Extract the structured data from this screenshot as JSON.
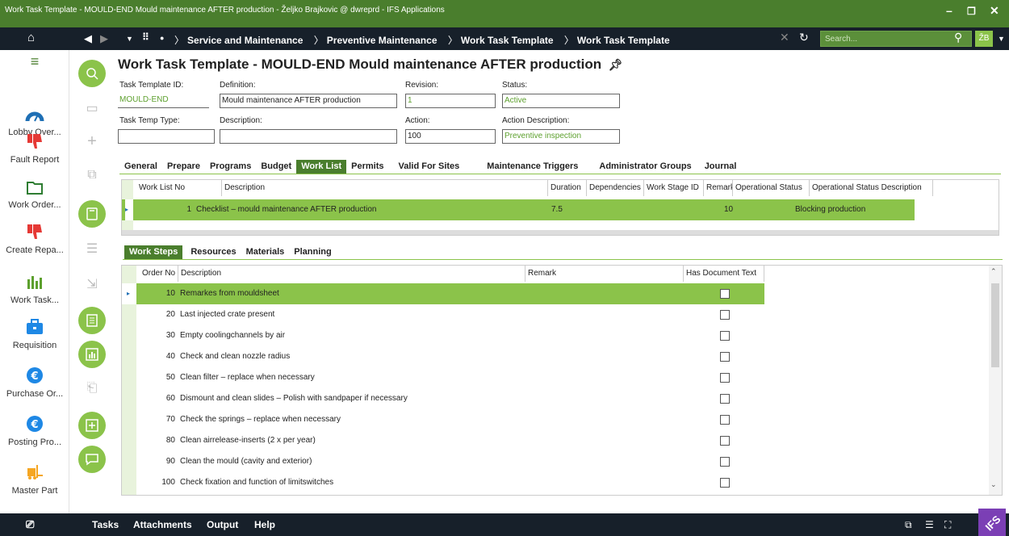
{
  "window": {
    "title": "Work Task Template - MOULD-END Mould maintenance AFTER production - Željko Brajkovic @ dwreprd - IFS Applications"
  },
  "nav": {
    "breadcrumbs": [
      "Service and Maintenance",
      "Preventive Maintenance",
      "Work Task Template",
      "Work Task Template"
    ],
    "search_placeholder": "Search...",
    "user_initials": "ŽB"
  },
  "sidebar": {
    "items": [
      {
        "label": "Lobby Over...",
        "icon": "gauge-icon"
      },
      {
        "label": "Fault Report",
        "icon": "thumbs-down-icon"
      },
      {
        "label": "Work Order...",
        "icon": "folder-icon"
      },
      {
        "label": "Create Repa...",
        "icon": "thumbs-down-icon"
      },
      {
        "label": "Work Task...",
        "icon": "bar-chart-icon"
      },
      {
        "label": "Requisition",
        "icon": "briefcase-icon"
      },
      {
        "label": "Purchase Or...",
        "icon": "euro-bag-icon"
      },
      {
        "label": "Posting Pro...",
        "icon": "euro-bag-icon"
      },
      {
        "label": "Master Part",
        "icon": "forklift-icon"
      }
    ]
  },
  "header": {
    "title": "Work Task Template - MOULD-END Mould maintenance AFTER production",
    "fields": {
      "task_template_id": {
        "label": "Task Template ID:",
        "value": "MOULD-END"
      },
      "definition": {
        "label": "Definition:",
        "value": "Mould maintenance AFTER production"
      },
      "revision": {
        "label": "Revision:",
        "value": "1"
      },
      "status": {
        "label": "Status:",
        "value": "Active"
      },
      "task_temp_type": {
        "label": "Task Temp Type:",
        "value": ""
      },
      "description": {
        "label": "Description:",
        "value": ""
      },
      "action": {
        "label": "Action:",
        "value": "100"
      },
      "action_description": {
        "label": "Action Description:",
        "value": "Preventive inspection"
      }
    }
  },
  "main_tabs": [
    "General",
    "Prepare",
    "Programs",
    "Budget",
    "Work List",
    "Permits",
    "Valid For Sites",
    "Maintenance Triggers",
    "Administrator Groups",
    "Journal"
  ],
  "work_list": {
    "columns": [
      "Work List No",
      "Description",
      "Duration",
      "Dependencies",
      "Work Stage ID",
      "Remark",
      "Operational Status",
      "Operational Status Description"
    ],
    "rows": [
      {
        "no": "1",
        "description": "Checklist – mould maintenance AFTER  production",
        "duration": "7.5",
        "dependencies": "",
        "work_stage_id": "",
        "remark": "",
        "op_status": "10",
        "op_status_desc": "Blocking production"
      }
    ]
  },
  "sub_tabs": [
    "Work Steps",
    "Resources",
    "Materials",
    "Planning"
  ],
  "work_steps": {
    "columns": [
      "Order No",
      "Description",
      "Remark",
      "Has Document Text"
    ],
    "rows": [
      {
        "order": "10",
        "description": "Remarkes from mouldsheet"
      },
      {
        "order": "20",
        "description": "Last  injected crate present"
      },
      {
        "order": "30",
        "description": "Empty coolingchannels by air"
      },
      {
        "order": "40",
        "description": "Check and clean nozzle radius"
      },
      {
        "order": "50",
        "description": "Clean filter – replace when necessary"
      },
      {
        "order": "60",
        "description": "Dismount and clean slides – Polish with sandpaper if necessary"
      },
      {
        "order": "70",
        "description": "Check the springs – replace when necessary"
      },
      {
        "order": "80",
        "description": "Clean airrelease-inserts (2 x per year)"
      },
      {
        "order": "90",
        "description": "Clean the mould (cavity and exterior)"
      },
      {
        "order": "100",
        "description": "Check fixation and function of limitswitches"
      }
    ]
  },
  "bottom": {
    "items": [
      "Tasks",
      "Attachments",
      "Output",
      "Help"
    ]
  }
}
